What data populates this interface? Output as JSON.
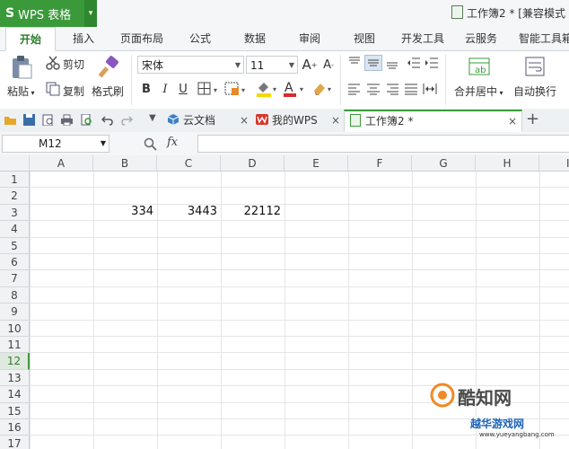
{
  "app": {
    "logo": "S",
    "name": "WPS 表格",
    "menu_arrow": "▾"
  },
  "window": {
    "doc_title": "工作簿2 * [兼容模式"
  },
  "menu_tabs": [
    "开始",
    "插入",
    "页面布局",
    "公式",
    "数据",
    "审阅",
    "视图",
    "开发工具",
    "云服务",
    "智能工具箱"
  ],
  "ribbon": {
    "paste": "粘贴",
    "cut": "剪切",
    "copy": "复制",
    "format_painter": "格式刷",
    "font_name": "宋体",
    "font_size": "11",
    "bold": "B",
    "italic": "I",
    "underline": "U",
    "merge_center": "合并居中",
    "wrap_text": "自动换行"
  },
  "doc_tabs": [
    {
      "label": "云文档"
    },
    {
      "label": "我的WPS"
    },
    {
      "label": "工作簿2 *"
    }
  ],
  "tab_close": "×",
  "tab_add": "+",
  "formula_bar": {
    "name_box": "M12",
    "fx": "fx",
    "value": ""
  },
  "sheet": {
    "columns": [
      "A",
      "B",
      "C",
      "D",
      "E",
      "F",
      "G",
      "H",
      "I"
    ],
    "rows": [
      "1",
      "2",
      "3",
      "4",
      "5",
      "6",
      "7",
      "8",
      "9",
      "10",
      "11",
      "12",
      "13",
      "14",
      "15",
      "16",
      "17"
    ],
    "active_row": "12",
    "cells": [
      {
        "ref": "B3",
        "value": "334"
      },
      {
        "ref": "C3",
        "value": "3443"
      },
      {
        "ref": "D3",
        "value": "22112"
      }
    ]
  },
  "watermark": {
    "line1": "酷知网",
    "line2": "越华游戏网",
    "url": "www.yueyangbang.com"
  },
  "colors": {
    "brand": "#3a9a3a",
    "grid": "#e3e6e9",
    "font_red": "#d62b2b",
    "highlight_yellow": "#f5d800"
  }
}
